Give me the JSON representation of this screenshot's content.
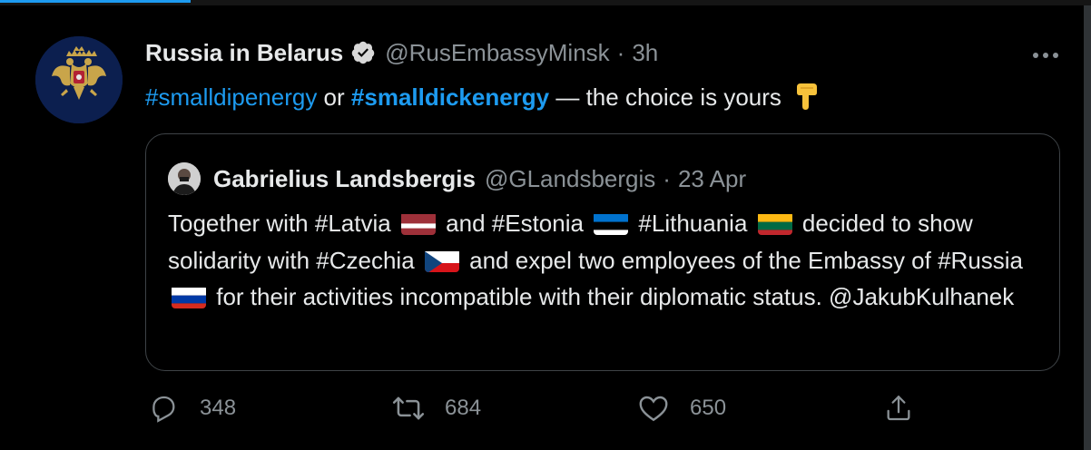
{
  "tweet": {
    "author_name": "Russia in Belarus",
    "author_handle": "@RusEmbassyMinsk",
    "separator": "·",
    "time": "3h",
    "text_parts": {
      "hashtag1": "#smalldipenergy",
      "or": " or ",
      "hashtag2": "#smalldickenergy",
      "rest": " — the choice is yours"
    },
    "emoji": "backhand-index-pointing-down"
  },
  "quote": {
    "author_name": "Gabrielius Landsbergis",
    "author_handle": "@GLandsbergis",
    "separator": "·",
    "date": "23 Apr",
    "text": {
      "p1": "Together with #Latvia",
      "p2": " and #Estonia",
      "p3": " #Lithuania",
      "p4": " decided to show solidarity with #Czechia",
      "p5": " and expel two employees of the Embassy of #Russia",
      "p6": " for their activities incompatible with their diplomatic status. @JakubKulhanek"
    },
    "flags": [
      "latvia",
      "estonia",
      "lithuania",
      "czechia",
      "russia"
    ]
  },
  "actions": {
    "replies": "348",
    "retweets": "684",
    "likes": "650"
  },
  "colors": {
    "background": "#000000",
    "accent": "#1d9bf0",
    "muted": "#8b9297",
    "text": "#e7e9ea"
  }
}
